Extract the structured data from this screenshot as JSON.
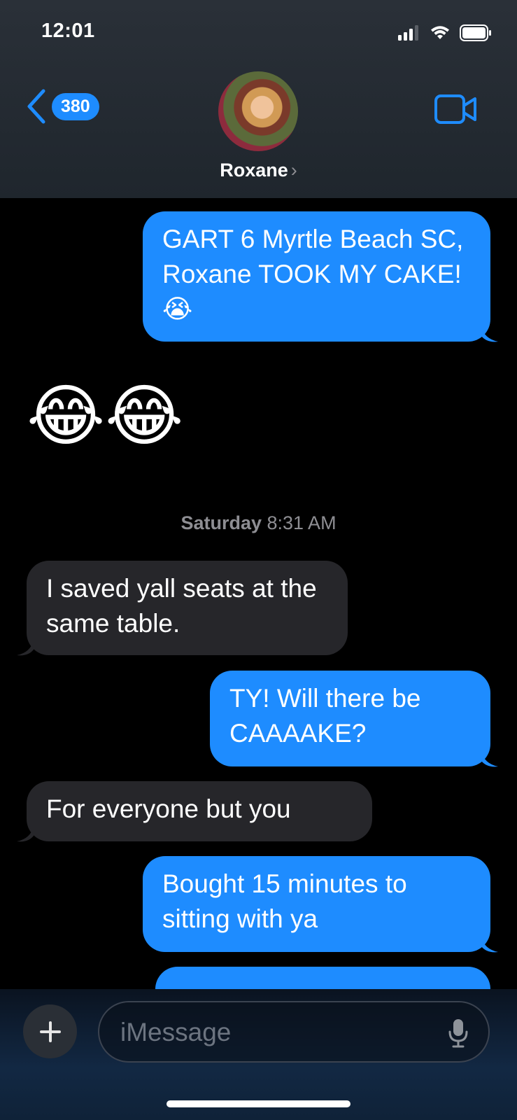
{
  "status": {
    "time": "12:01"
  },
  "header": {
    "back_count": "380",
    "contact_name": "Roxane",
    "chevron": "›"
  },
  "messages": [
    {
      "dir": "out",
      "text": "GART 6 Myrtle Beach SC, Roxane TOOK MY CAKE! 😭"
    },
    {
      "dir": "in",
      "text": "😂😂"
    },
    {
      "dir": "in",
      "text": "I saved yall seats at the same table."
    },
    {
      "dir": "out",
      "text": "TY! Will there be CAAAAKE?"
    },
    {
      "dir": "in",
      "text": "For everyone but you"
    },
    {
      "dir": "out",
      "text": "Bought 15 minutes to sitting with ya"
    }
  ],
  "timestamp": {
    "day": "Saturday",
    "time": "8:31 AM"
  },
  "input": {
    "placeholder": "iMessage"
  },
  "icons": [
    "back-chevron-icon",
    "video-call-icon",
    "signal-icon",
    "wifi-icon",
    "battery-icon",
    "plus-icon",
    "microphone-icon"
  ],
  "colors": {
    "outgoing": "#1e8cff",
    "incoming": "#26262a",
    "background": "#000000"
  }
}
